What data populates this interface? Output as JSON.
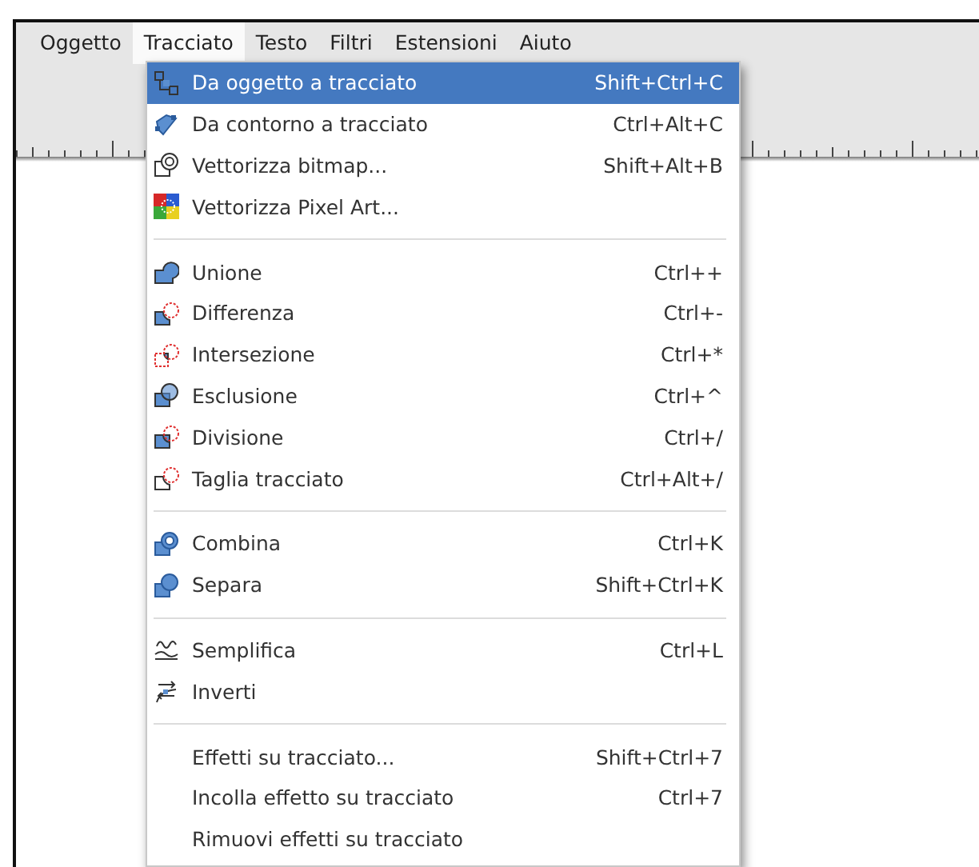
{
  "menubar": [
    {
      "label": "Oggetto",
      "selected": false
    },
    {
      "label": "Tracciato",
      "selected": true
    },
    {
      "label": "Testo",
      "selected": false
    },
    {
      "label": "Filtri",
      "selected": false
    },
    {
      "label": "Estensioni",
      "selected": false
    },
    {
      "label": "Aiuto",
      "selected": false
    }
  ],
  "menu": {
    "items": [
      {
        "kind": "item",
        "label": "Da oggetto a tracciato",
        "shortcut": "Shift+Ctrl+C",
        "selected": true
      },
      {
        "kind": "item",
        "label": "Da contorno a tracciato",
        "shortcut": "Ctrl+Alt+C",
        "selected": false
      },
      {
        "kind": "item",
        "label": "Vettorizza bitmap...",
        "shortcut": "Shift+Alt+B",
        "selected": false
      },
      {
        "kind": "item",
        "label": "Vettorizza Pixel Art...",
        "selected": false
      },
      {
        "kind": "separator"
      },
      {
        "kind": "item",
        "label": "Unione",
        "shortcut": "Ctrl++",
        "selected": false
      },
      {
        "kind": "item",
        "label": "Differenza",
        "shortcut": "Ctrl+-",
        "selected": false
      },
      {
        "kind": "item",
        "label": "Intersezione",
        "shortcut": "Ctrl+*",
        "selected": false
      },
      {
        "kind": "item",
        "label": "Esclusione",
        "shortcut": "Ctrl+^",
        "selected": false
      },
      {
        "kind": "item",
        "label": "Divisione",
        "shortcut": "Ctrl+/",
        "selected": false
      },
      {
        "kind": "item",
        "label": "Taglia tracciato",
        "shortcut": "Ctrl+Alt+/",
        "selected": false
      },
      {
        "kind": "separator"
      },
      {
        "kind": "item",
        "label": "Combina",
        "shortcut": "Ctrl+K",
        "selected": false
      },
      {
        "kind": "item",
        "label": "Separa",
        "shortcut": "Shift+Ctrl+K",
        "selected": false
      },
      {
        "kind": "separator"
      },
      {
        "kind": "item",
        "label": "Semplifica",
        "shortcut": "Ctrl+L",
        "selected": false
      },
      {
        "kind": "item",
        "label": "Inverti",
        "selected": false
      },
      {
        "kind": "separator"
      },
      {
        "kind": "item",
        "label": "Effetti su tracciato...",
        "shortcut": "Shift+Ctrl+7",
        "selected": false
      },
      {
        "kind": "item",
        "label": "Incolla effetto su tracciato",
        "shortcut": "Ctrl+7",
        "selected": false
      },
      {
        "kind": "item",
        "label": "Rimuovi effetti su tracciato",
        "selected": false
      }
    ]
  }
}
